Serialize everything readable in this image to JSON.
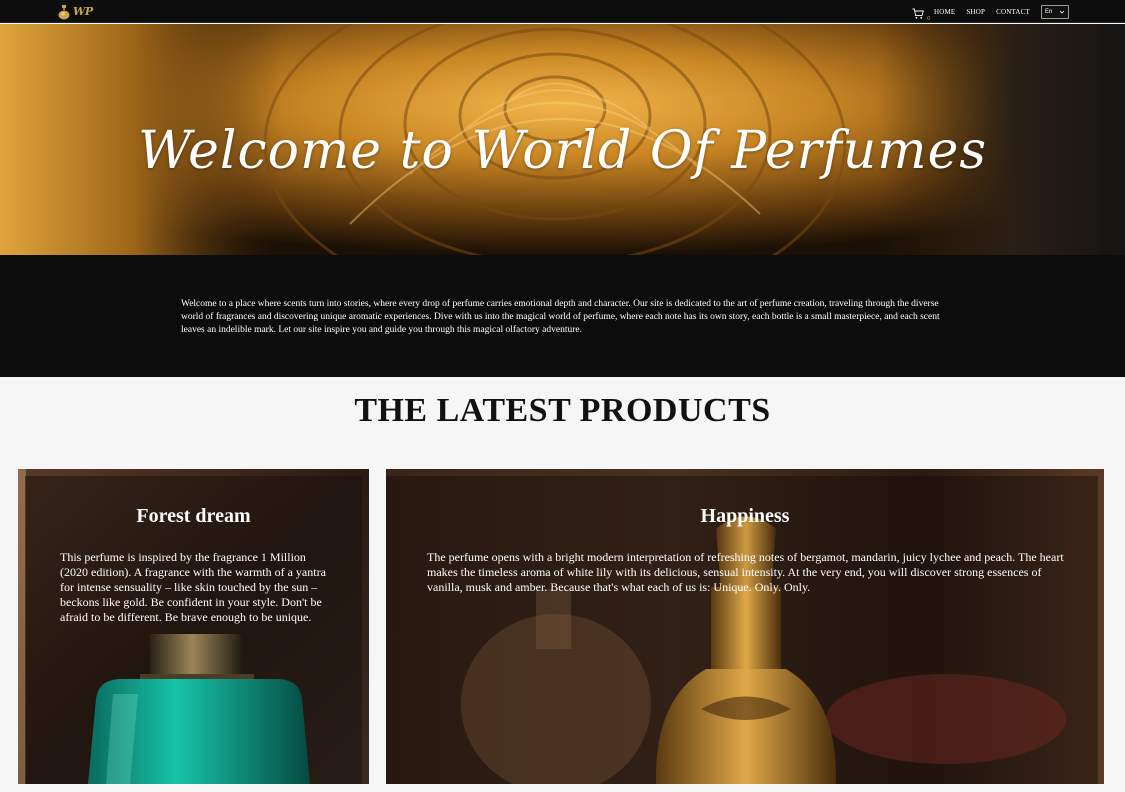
{
  "nav": {
    "logo_text": "WP",
    "cart_count": "0",
    "links": [
      "HOME",
      "SHOP",
      "CONTACT"
    ],
    "language": "En"
  },
  "hero": {
    "title": "Welcome to World Of Perfumes"
  },
  "intro": {
    "text": "Welcome to a place where scents turn into stories, where every drop of perfume carries emotional depth and character. Our site is dedicated to the art of perfume creation, traveling through the diverse world of fragrances and discovering unique aromatic experiences. Dive with us into the magical world of perfume, where each note has its own story, each bottle is a small masterpiece, and each scent leaves an indelible mark. Let our site inspire you and guide you through this magical olfactory adventure."
  },
  "latest": {
    "title": "THE LATEST PRODUCTS",
    "products": [
      {
        "name": "Forest dream",
        "description": "This perfume is inspired by the fragrance 1 Million (2020 edition). A fragrance with the warmth of a yantra for intense sensuality – like skin touched by the sun – beckons like gold. Be confident in your style. Don't be afraid to be different. Be brave enough to be unique."
      },
      {
        "name": "Happiness",
        "description": "The perfume opens with a bright modern interpretation of refreshing notes of bergamot, mandarin, juicy lychee and peach. The heart makes the timeless aroma of white lily with its delicious, sensual intensity. At the very end, you will discover strong essences of vanilla, musk and amber. Because that's what each of us is: Unique. Only. Only."
      }
    ]
  },
  "colors": {
    "nav_bg": "#0d0d0d",
    "intro_bg": "#0c0c0c",
    "page_bg": "#f6f6f6",
    "gold": "#d4a84a"
  },
  "icons": [
    "perfume-logo-icon",
    "cart-icon",
    "chevron-down-icon"
  ]
}
